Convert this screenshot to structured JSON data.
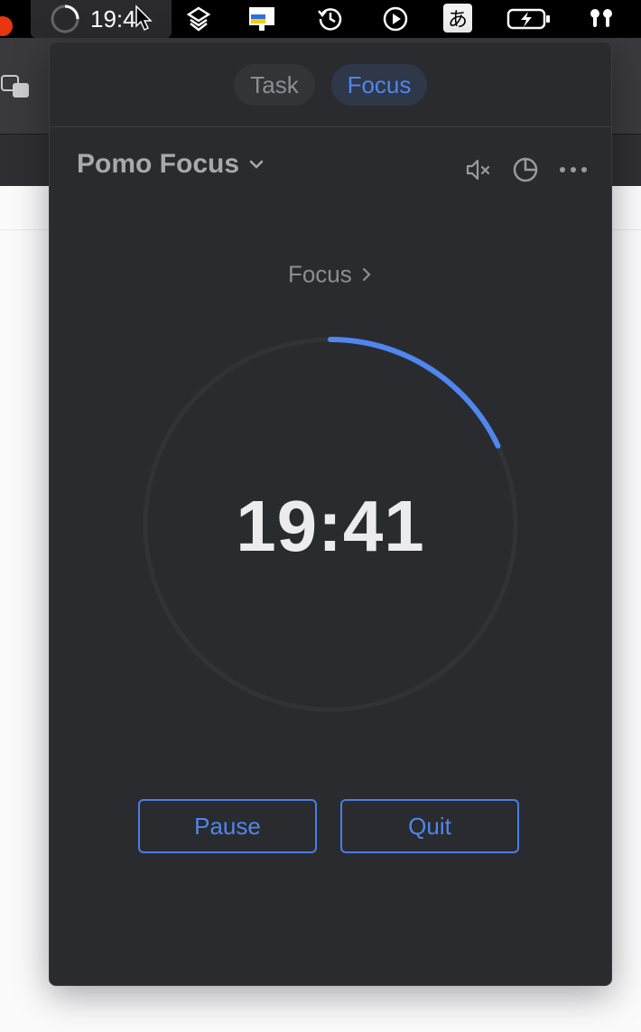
{
  "menubar": {
    "clock": "19:4",
    "input_method": "あ",
    "icons": [
      "progress-ring-icon",
      "cursor-icon",
      "layers-icon",
      "flag-monitor-icon",
      "time-machine-icon",
      "play-circle-icon",
      "battery-charging-icon",
      "airpods-icon"
    ]
  },
  "tabs": [
    {
      "label": "Task",
      "active": false
    },
    {
      "label": "Focus",
      "active": true
    }
  ],
  "header": {
    "title": "Pomo Focus",
    "icons": [
      "mute-icon",
      "pie-chart-icon",
      "more-icon"
    ]
  },
  "timer": {
    "mode_label": "Focus",
    "time": "19:41",
    "progress": 0.18
  },
  "buttons": {
    "pause": "Pause",
    "quit": "Quit"
  },
  "colors": {
    "accent": "#4f86ef",
    "panel_bg": "#2a2b2e",
    "ring_track": "#323337"
  }
}
